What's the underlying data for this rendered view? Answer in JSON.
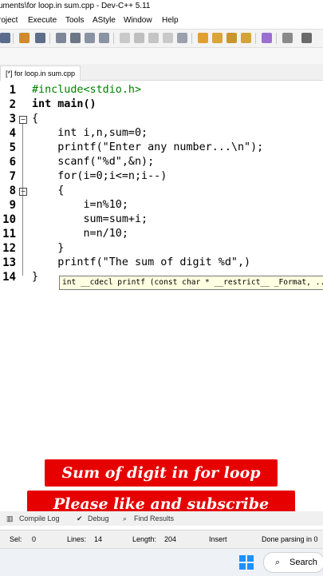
{
  "window": {
    "title": "uments\\for loop.in sum.cpp - Dev-C++ 5.11"
  },
  "menu": [
    "roject",
    "Execute",
    "Tools",
    "AStyle",
    "Window",
    "Help"
  ],
  "toolbar_icons": [
    "new-icon",
    "open-icon",
    "save-icon",
    "compile-icon",
    "run-icon",
    "debug-icon",
    "check-icon",
    "close-icon"
  ],
  "tab": {
    "label": "[*] for loop.in sum.cpp"
  },
  "editor": {
    "line_numbers": [
      "1",
      "2",
      "3",
      "4",
      "5",
      "6",
      "7",
      "8",
      "9",
      "10",
      "11",
      "12",
      "13",
      "14"
    ],
    "lines": [
      "#include<stdio.h>",
      "int main()",
      "{",
      "    int i,n,sum=0;",
      "    printf(\"Enter any number...\\n\");",
      "    scanf(\"%d\",&n);",
      "    for(i=0;i<=n;i--)",
      "    {",
      "        i=n%10;",
      "        sum=sum+i;",
      "        n=n/10;",
      "    }",
      "    printf(\"The sum of digit %d\",)",
      "}"
    ],
    "tooltip": "int __cdecl printf (const char * __restrict__ _Format, ..."
  },
  "banners": {
    "line1": "Sum of digit in for loop",
    "line2": "Please like and subscribe"
  },
  "bottom_tabs": [
    "Compile Log",
    "Debug",
    "Find Results"
  ],
  "status": {
    "sel_label": "Sel:",
    "sel_value": "0",
    "lines_label": "Lines:",
    "lines_value": "14",
    "length_label": "Length:",
    "length_value": "204",
    "mode": "Insert",
    "message": "Done parsing in 0"
  },
  "taskbar": {
    "search_label": "Search"
  },
  "colors": {
    "keyword": "#000000",
    "string": "#e00000",
    "number": "#8000ff",
    "preprocessor": "#008000",
    "banner": "#e60000"
  }
}
